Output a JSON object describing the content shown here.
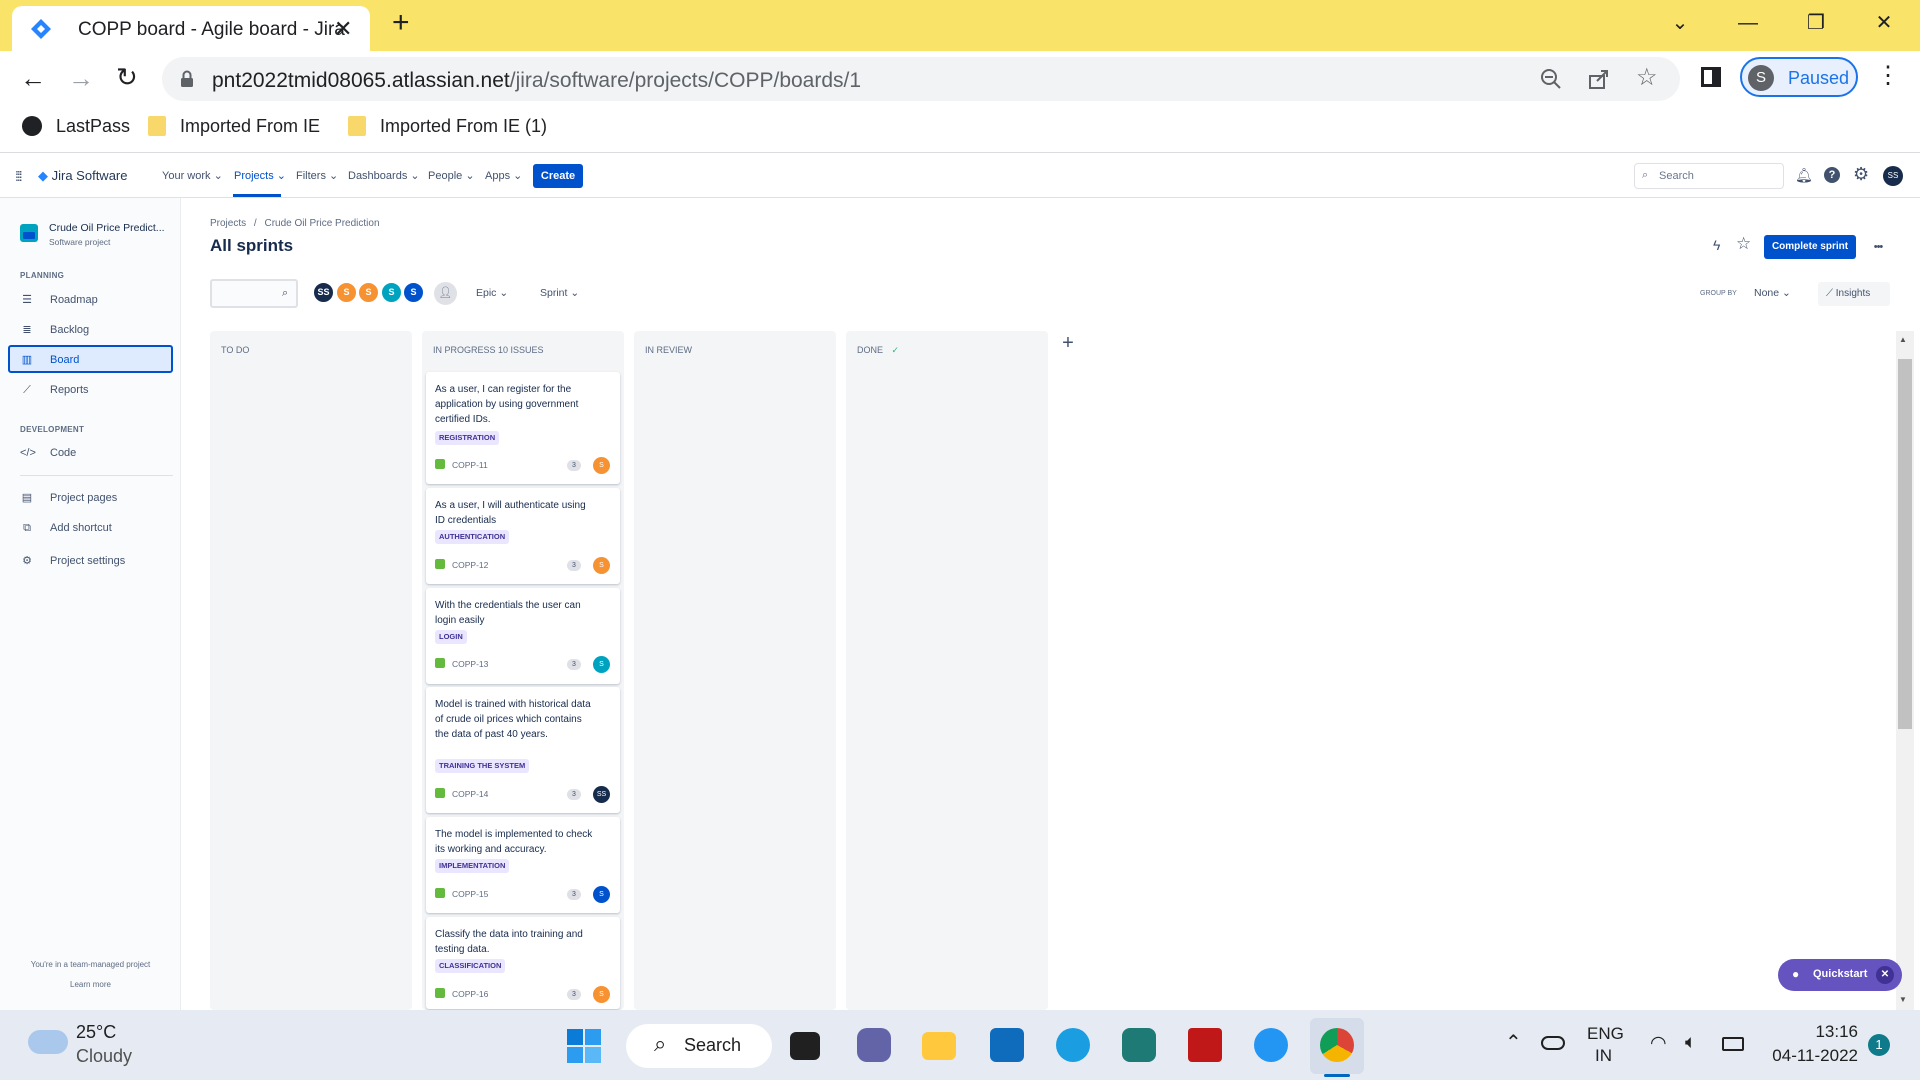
{
  "browser": {
    "tab_title": "COPP board - Agile board - Jira",
    "url_host": "pnt2022tmid08065.atlassian.net",
    "url_path": "/jira/software/projects/COPP/boards/1",
    "profile_initial": "S",
    "profile_status": "Paused",
    "bookmarks": [
      "LastPass",
      "Imported From IE",
      "Imported From IE (1)"
    ]
  },
  "jira_nav": {
    "product": "Jira Software",
    "items": [
      "Your work",
      "Projects",
      "Filters",
      "Dashboards",
      "People",
      "Apps"
    ],
    "create": "Create",
    "search_placeholder": "Search",
    "account_initials": "SS"
  },
  "sidebar": {
    "project_name": "Crude Oil Price Predict...",
    "project_type": "Software project",
    "planning_label": "PLANNING",
    "planning_items": [
      "Roadmap",
      "Backlog",
      "Board",
      "Reports"
    ],
    "development_label": "DEVELOPMENT",
    "development_items": [
      "Code"
    ],
    "other_items": [
      "Project pages",
      "Add shortcut",
      "Project settings"
    ],
    "footer_text": "You're in a team-managed project",
    "footer_link": "Learn more"
  },
  "header": {
    "breadcrumb_root": "Projects",
    "breadcrumb_sep": "/",
    "breadcrumb_project": "Crude Oil Price Prediction",
    "title": "All sprints",
    "complete_sprint": "Complete sprint",
    "more": "•••"
  },
  "filters": {
    "avatars": [
      {
        "label": "SS",
        "color": "#172b4d"
      },
      {
        "label": "S",
        "color": "#f79232"
      },
      {
        "label": "S",
        "color": "#f79232"
      },
      {
        "label": "S",
        "color": "#00a3bf"
      },
      {
        "label": "S",
        "color": "#0052cc"
      }
    ],
    "epic": "Epic",
    "sprint": "Sprint",
    "group_by_label": "GROUP BY",
    "group_by_value": "None",
    "insights": "Insights"
  },
  "columns": [
    {
      "title": "TO DO",
      "count": ""
    },
    {
      "title": "IN PROGRESS",
      "count": "10 ISSUES"
    },
    {
      "title": "IN REVIEW",
      "count": ""
    },
    {
      "title": "DONE",
      "count": "✓"
    }
  ],
  "cards": [
    {
      "summary": "As a user, I can register for the application by using government certified IDs.",
      "epic": "REGISTRATION",
      "key": "COPP-11",
      "points": "3",
      "assignee": "S",
      "color": "#f79232"
    },
    {
      "summary": "As a user, I will authenticate using ID credentials",
      "epic": "AUTHENTICATION",
      "key": "COPP-12",
      "points": "3",
      "assignee": "S",
      "color": "#f79232"
    },
    {
      "summary": "With the credentials the user can login easily",
      "epic": "LOGIN",
      "key": "COPP-13",
      "points": "3",
      "assignee": "S",
      "color": "#00a3bf"
    },
    {
      "summary": "Model is trained with historical data of crude oil prices which contains the data of past 40 years.",
      "epic": "TRAINING THE SYSTEM",
      "key": "COPP-14",
      "points": "3",
      "assignee": "SS",
      "color": "#172b4d"
    },
    {
      "summary": "The model is implemented to check its working and accuracy.",
      "epic": "IMPLEMENTATION",
      "key": "COPP-15",
      "points": "3",
      "assignee": "S",
      "color": "#0052cc"
    },
    {
      "summary": "Classify the data into training and testing data.",
      "epic": "CLASSIFICATION",
      "key": "COPP-16",
      "points": "3",
      "assignee": "S",
      "color": "#f79232"
    }
  ],
  "quickstart": "Quickstart",
  "taskbar": {
    "weather_temp": "25°C",
    "weather_desc": "Cloudy",
    "search": "Search",
    "lang_1": "ENG",
    "lang_2": "IN",
    "time": "13:16",
    "date": "04-11-2022",
    "notifications": "1"
  }
}
